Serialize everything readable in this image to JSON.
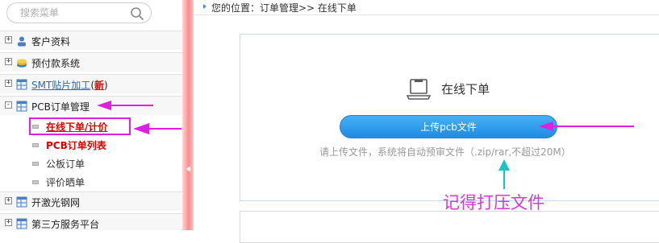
{
  "sidebar": {
    "search_placeholder": "搜索菜单",
    "menu": [
      {
        "label": "客户资料"
      },
      {
        "label": "预付款系统"
      },
      {
        "label": "SMT贴片加工",
        "badge": "新"
      },
      {
        "label": "PCB订单管理"
      }
    ],
    "submenu": [
      {
        "label": "在线下单/计价"
      },
      {
        "label": "PCB订单列表"
      },
      {
        "label": "公板订单"
      },
      {
        "label": "评价晒单"
      }
    ],
    "menu_lower": [
      {
        "label": "开激光钢网"
      },
      {
        "label": "第三方服务平台"
      }
    ],
    "expand_symbol": "+",
    "collapse_symbol": "-"
  },
  "breadcrumb": {
    "text": "您的位置：订单管理>> 在线下单"
  },
  "main": {
    "title": "在线下单",
    "upload_button": "上传pcb文件",
    "hint": "请上传文件，系统将自动预审文件（.zip/rar,不超过20M）"
  },
  "annotation": {
    "note": "记得打压文件"
  },
  "colors": {
    "accent_blue": "#1e8be3",
    "annotation_magenta": "#e020e0",
    "annotation_teal": "#17c6c0",
    "divider_pink": "#ff8888",
    "active_red": "#e00000"
  }
}
